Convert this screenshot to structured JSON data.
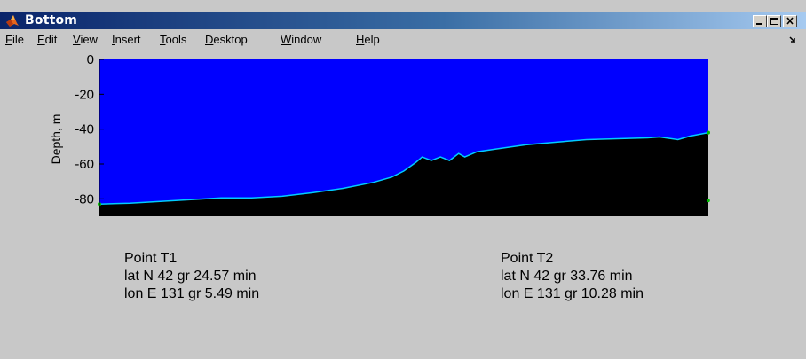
{
  "window": {
    "title": "Bottom",
    "controls": {
      "minimize": "minimize",
      "maximize": "maximize",
      "close": "close"
    }
  },
  "menu": [
    {
      "mnemonic": "F",
      "rest": "ile"
    },
    {
      "mnemonic": "E",
      "rest": "dit"
    },
    {
      "mnemonic": "V",
      "rest": "iew"
    },
    {
      "mnemonic": "I",
      "rest": "nsert"
    },
    {
      "mnemonic": "T",
      "rest": "ools"
    },
    {
      "mnemonic": "D",
      "rest": "esktop"
    },
    {
      "mnemonic": "W",
      "rest": "indow"
    },
    {
      "mnemonic": "H",
      "rest": "elp"
    }
  ],
  "chart_data": {
    "type": "area",
    "ylabel": "Depth, m",
    "ylim": [
      -90,
      0
    ],
    "yticks": [
      "0",
      "-20",
      "-40",
      "-60",
      "-80"
    ],
    "ytick_values": [
      0,
      -20,
      -40,
      -60,
      -80
    ],
    "xlim": [
      0,
      1
    ],
    "grid": false,
    "colors": {
      "water": "#0000ff",
      "seabed": "#000000",
      "profile_line": "#00ccff",
      "endpoint_marker": "#00c000"
    },
    "series": [
      {
        "x": [
          0,
          0.05,
          0.1,
          0.15,
          0.2,
          0.25,
          0.3,
          0.35,
          0.4,
          0.45,
          0.48,
          0.5,
          0.52,
          0.53,
          0.545,
          0.56,
          0.575,
          0.59,
          0.6,
          0.62,
          0.65,
          0.7,
          0.75,
          0.8,
          0.85,
          0.9,
          0.92,
          0.95,
          0.97,
          1.0
        ],
        "y": [
          -83,
          -82.5,
          -81.5,
          -80.5,
          -79.5,
          -79.5,
          -78.5,
          -76.5,
          -74,
          -70.5,
          -67.5,
          -64,
          -59,
          -56,
          -58,
          -56,
          -58,
          -54,
          -56,
          -53,
          -51.5,
          -49,
          -47.5,
          -46,
          -45.5,
          -45,
          -44.5,
          -46,
          -44,
          -42
        ]
      }
    ]
  },
  "points": {
    "t1": {
      "name": "Point T1",
      "lat": "lat N 42 gr 24.57 min",
      "lon": "lon E 131 gr 5.49 min"
    },
    "t2": {
      "name": "Point T2",
      "lat": "lat N 42 gr 33.76 min",
      "lon": "lon E 131 gr 10.28 min"
    }
  }
}
